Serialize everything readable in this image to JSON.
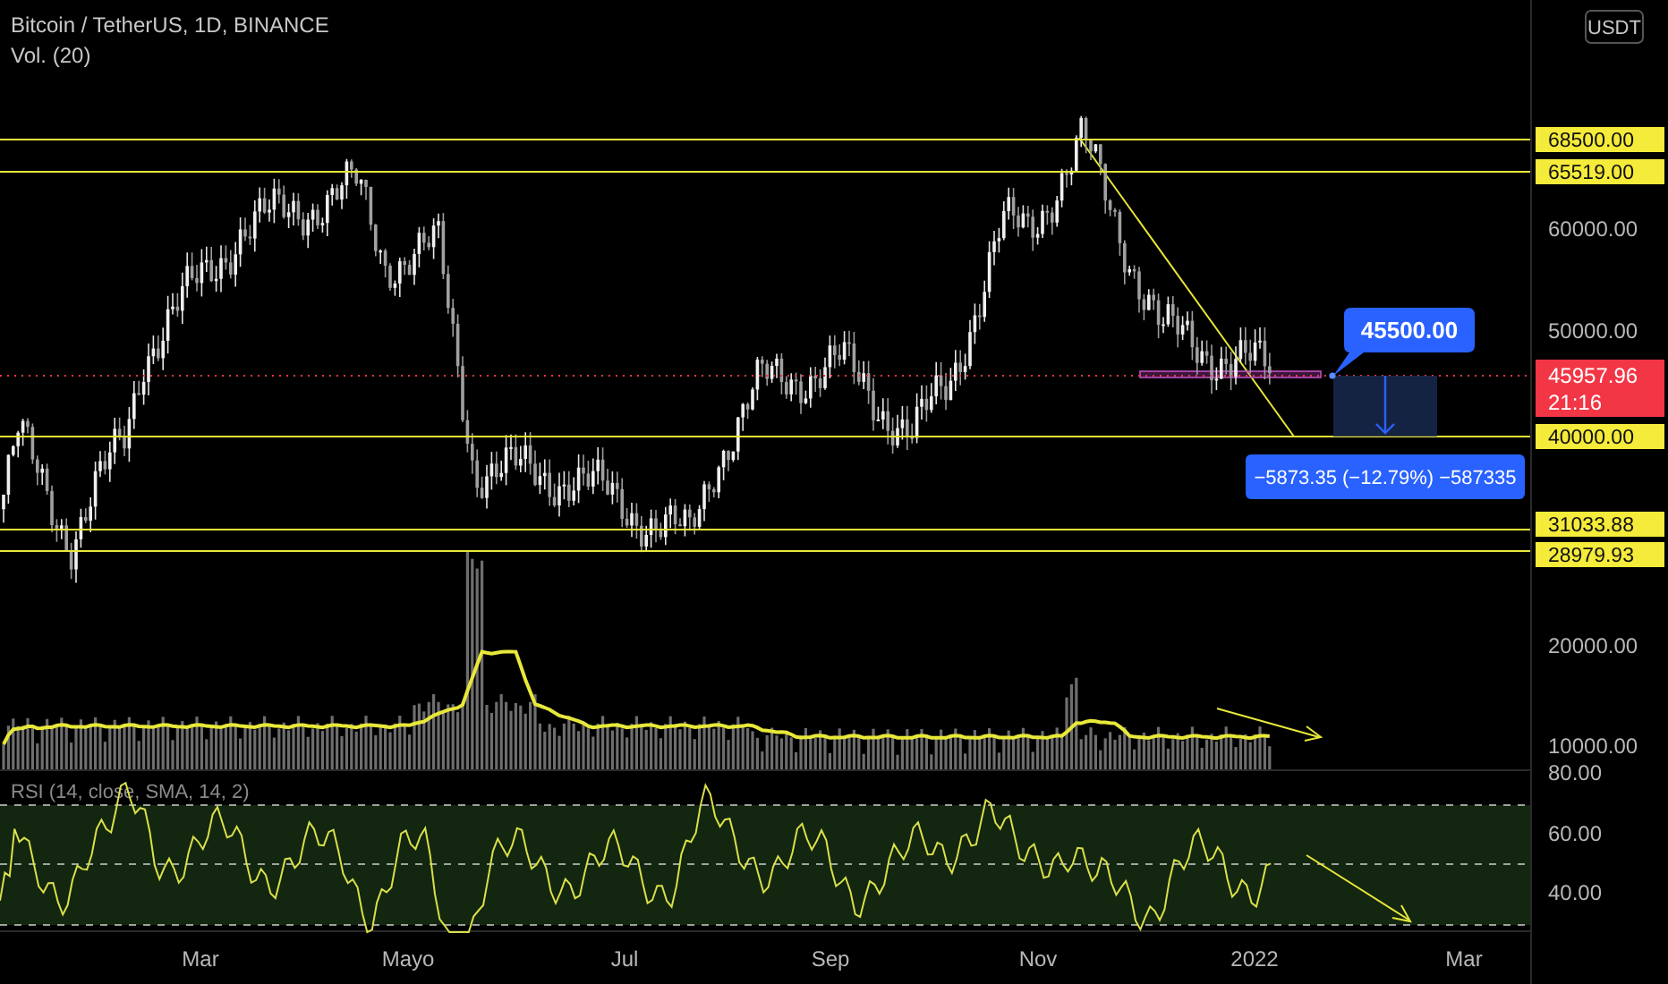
{
  "header": {
    "title": "Bitcoin / TetherUS, 1D, BINANCE",
    "volume_label": "Vol. (20)"
  },
  "price_axis": {
    "currency": "USDT",
    "ticks": [
      "60000.00",
      "50000.00",
      "20000.00",
      "10000.00"
    ]
  },
  "price_levels": [
    {
      "label": "68500.00"
    },
    {
      "label": "65519.00"
    },
    {
      "label": "40000.00"
    },
    {
      "label": "31033.88"
    },
    {
      "label": "28979.93"
    }
  ],
  "last_price": {
    "price": "45957.96",
    "countdown": "21:16"
  },
  "annotations": {
    "target_label": "45500.00",
    "measure_label": "−5873.35 (−12.79%) −587335"
  },
  "rsi": {
    "label": "RSI (14, close, SMA, 14, 2)",
    "ticks": [
      "80.00",
      "60.00",
      "40.00"
    ]
  },
  "time_axis": [
    "Mar",
    "Mayo",
    "Jul",
    "Sep",
    "Nov",
    "2022",
    "Mar"
  ]
}
